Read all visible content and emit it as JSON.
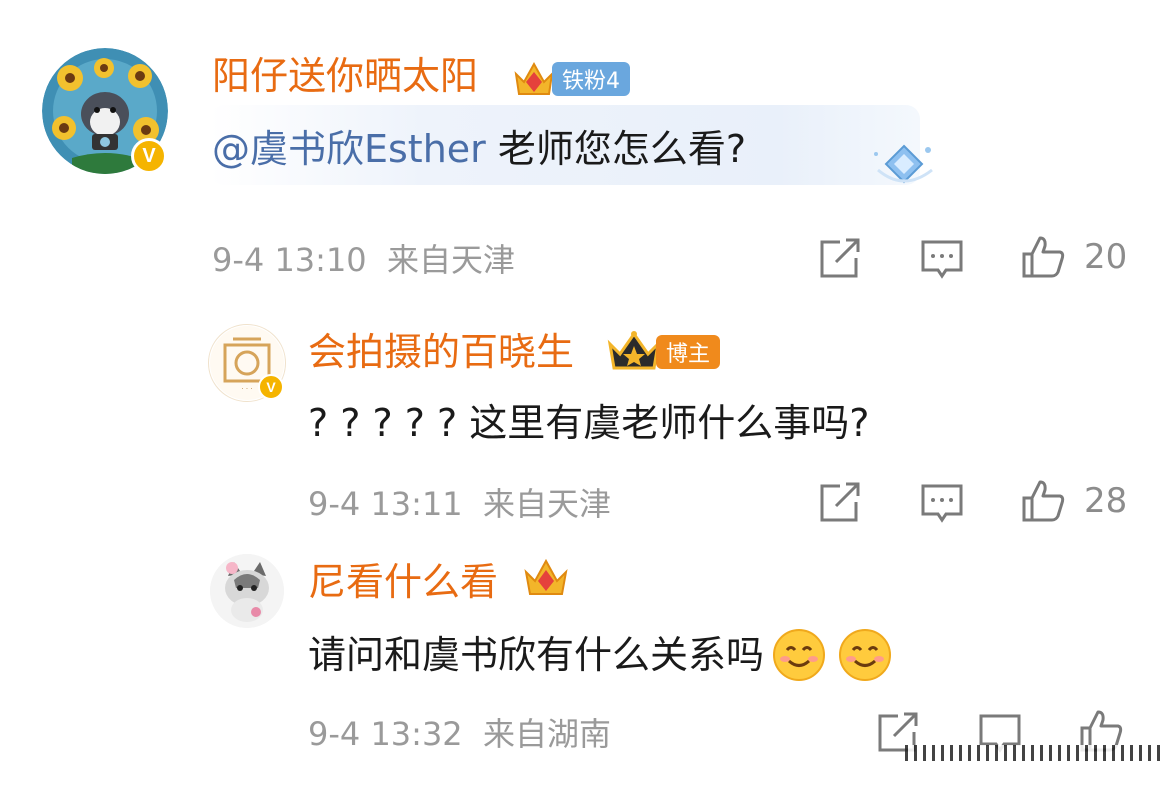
{
  "comments": [
    {
      "username": "阳仔送你晒太阳",
      "fan_badge": "铁粉4",
      "mention": "@虞书欣Esther",
      "text": " 老师您怎么看?",
      "time": "9-4 13:10",
      "location": "来自天津",
      "likes": "20",
      "verified_mark": "V"
    },
    {
      "username": "会拍摄的百晓生",
      "role_badge": "博主",
      "text": "? ? ? ? ?  这里有虞老师什么事吗?",
      "time": "9-4 13:11",
      "location": "来自天津",
      "likes": "28",
      "verified_mark": "V"
    },
    {
      "username": "尼看什么看",
      "text": "请问和虞书欣有什么关系吗",
      "time": "9-4 13:32",
      "location": "来自湖南",
      "likes": ""
    }
  ],
  "icons": {
    "share": "share-icon",
    "comment": "comment-icon",
    "like": "like-icon",
    "emoji": "smile-emoji"
  },
  "colors": {
    "username": "#e86b12",
    "mention": "#4a6ea8",
    "meta": "#9a9a9a",
    "fan_badge": "#5b9bd5",
    "role_badge": "#f08a1c",
    "verified": "#f5b400"
  }
}
